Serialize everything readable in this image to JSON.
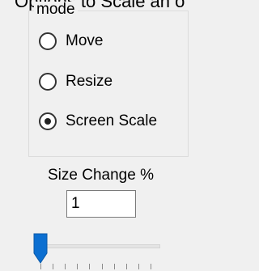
{
  "header": {
    "caption": "Options to Scale an o"
  },
  "mode_group": {
    "legend": "mode",
    "options": [
      {
        "label": "Move",
        "selected": false
      },
      {
        "label": "Resize",
        "selected": false
      },
      {
        "label": "Screen Scale",
        "selected": true
      }
    ]
  },
  "size_change": {
    "label": "Size Change %",
    "value": "1"
  },
  "slider": {
    "position_fraction": 0.0,
    "tick_count": 10
  },
  "colors": {
    "background": "#f0f0f0",
    "thumb": "#0c6fd1"
  }
}
